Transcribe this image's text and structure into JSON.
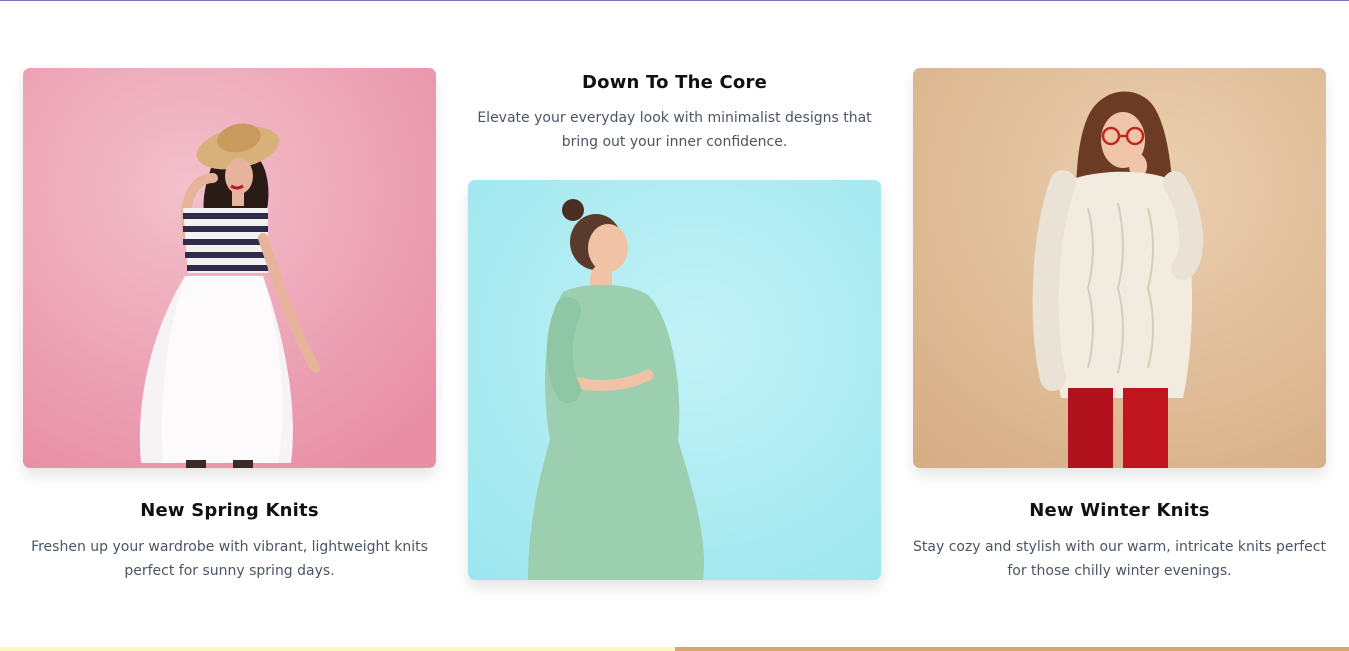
{
  "cards": [
    {
      "id": "spring",
      "title": "New Spring Knits",
      "description": "Freshen up your wardrobe with vibrant, lightweight knits perfect for sunny spring days.",
      "image": "woman-in-hat-striped-top-white-tulle-skirt",
      "background_color": "#ec9db1"
    },
    {
      "id": "core",
      "title": "Down To The Core",
      "description": "Elevate your everyday look with minimalist designs that bring out your inner confidence.",
      "image": "woman-in-green-dress",
      "background_color": "#a9ecf3"
    },
    {
      "id": "winter",
      "title": "New Winter Knits",
      "description": "Stay cozy and stylish with our warm, intricate knits perfect for those chilly winter evenings.",
      "image": "woman-in-cream-knit-sweater-red-leggings",
      "background_color": "#e2c2a0"
    }
  ],
  "colors": {
    "top_accent": "#7a73c7",
    "bottom_bar_left": "#fdf6c8",
    "bottom_bar_right": "#d6a86a",
    "title": "#111111",
    "description": "#4b5563"
  }
}
